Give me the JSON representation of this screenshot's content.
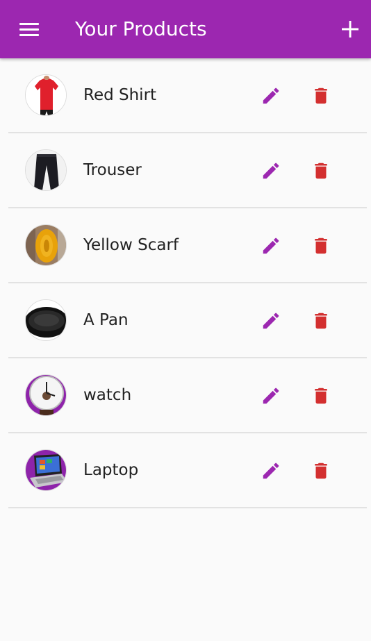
{
  "app_bar": {
    "title": "Your Products",
    "background_color": "#9c27b0",
    "menu_icon": "menu-icon",
    "add_icon": "add-icon"
  },
  "colors": {
    "edit": "#9c27b0",
    "delete": "#d32f2f"
  },
  "products": [
    {
      "title": "Red Shirt",
      "thumbnail": "red-shirt-image"
    },
    {
      "title": "Trouser",
      "thumbnail": "trouser-image"
    },
    {
      "title": "Yellow Scarf",
      "thumbnail": "yellow-scarf-image"
    },
    {
      "title": "A Pan",
      "thumbnail": "pan-image"
    },
    {
      "title": "watch",
      "thumbnail": "watch-image"
    },
    {
      "title": "Laptop",
      "thumbnail": "laptop-image"
    }
  ],
  "row_actions": {
    "edit_icon": "pencil-icon",
    "delete_icon": "trash-icon"
  }
}
